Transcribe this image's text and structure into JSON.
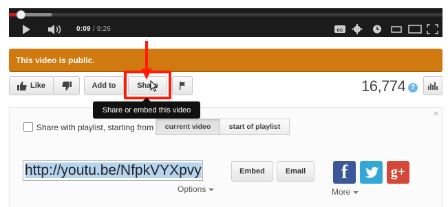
{
  "player": {
    "current_time": "0:09",
    "separator": "/",
    "duration": "9:26",
    "progress_fraction": 0.016
  },
  "banner": {
    "text": "This video is public."
  },
  "actions": {
    "like_label": "Like",
    "add_to_label": "Add to",
    "share_label": "Share"
  },
  "views": {
    "count": "16,774",
    "help_symbol": "?"
  },
  "tooltip": {
    "text": "Share or embed this video"
  },
  "share_panel": {
    "close_symbol": "×",
    "playlist_label": "Share with playlist, starting from",
    "segment_current": "current video",
    "segment_start": "start of playlist",
    "url_value": "http://youtu.be/NfpkVYXpvy",
    "options_label": "Options",
    "embed_label": "Embed",
    "email_label": "Email",
    "more_label": "More",
    "facebook_glyph": "f",
    "googleplus_glyph": "g+"
  },
  "colors": {
    "banner": "#d0790e",
    "highlight": "#ff1a0a",
    "facebook": "#3b5998",
    "twitter": "#33a8d8",
    "googleplus": "#d34836"
  },
  "icons": [
    "play-icon",
    "volume-icon",
    "captions-icon",
    "settings-icon",
    "watch-later-icon",
    "small-player-icon",
    "large-player-icon",
    "fullscreen-icon",
    "thumbs-up-icon",
    "thumbs-down-icon",
    "flag-icon",
    "stats-icon",
    "help-icon",
    "close-icon",
    "cursor-icon"
  ]
}
